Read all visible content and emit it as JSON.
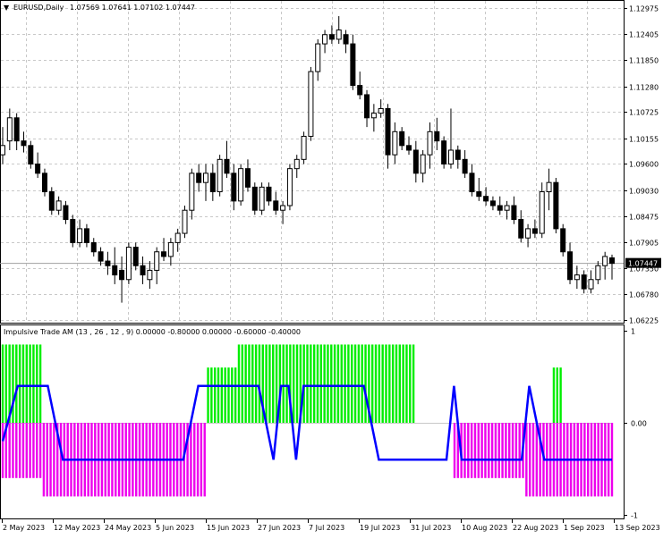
{
  "main_chart": {
    "title_prefix": "▼",
    "symbol_label": "EURUSD,Daily",
    "ohlc_text": "1.07569 1.07641 1.07102 1.07447",
    "current_price": "1.07447",
    "price_axis_ticks": [
      "1.12975",
      "1.12405",
      "1.11850",
      "1.11280",
      "1.10725",
      "1.10155",
      "1.09600",
      "1.09030",
      "1.08475",
      "1.07905",
      "1.07350",
      "1.06780",
      "1.06225"
    ],
    "colors": {
      "bull": "#ffffff",
      "bear": "#000000",
      "outline": "#000000",
      "grid": "#c0c0c0",
      "price_line": "#a0a0a0",
      "price_tag_bg": "#000000",
      "price_tag_text": "#ffffff"
    }
  },
  "indicator": {
    "title": "Impulsive Trade AM (13 , 26 , 12 , 9) 0.00000 -0.80000 0.00000 -0.60000 -0.40000",
    "axis_ticks": [
      "1",
      "0.00",
      "-1"
    ],
    "colors": {
      "up": "#00ee00",
      "down": "#ee00ee",
      "line": "#0000ff"
    }
  },
  "time_axis": [
    "2 May 2023",
    "12 May 2023",
    "24 May 2023",
    "5 Jun 2023",
    "15 Jun 2023",
    "27 Jun 2023",
    "7 Jul 2023",
    "19 Jul 2023",
    "31 Jul 2023",
    "10 Aug 2023",
    "22 Aug 2023",
    "1 Sep 2023",
    "13 Sep 2023"
  ],
  "chart_data": [
    {
      "type": "candlestick",
      "symbol": "EURUSD",
      "timeframe": "Daily",
      "ylim": [
        1.06225,
        1.12975
      ],
      "candles": [
        {
          "o": 1.098,
          "h": 1.104,
          "l": 1.096,
          "c": 1.1
        },
        {
          "o": 1.101,
          "h": 1.108,
          "l": 1.099,
          "c": 1.106
        },
        {
          "o": 1.106,
          "h": 1.107,
          "l": 1.099,
          "c": 1.101
        },
        {
          "o": 1.101,
          "h": 1.103,
          "l": 1.0985,
          "c": 1.1
        },
        {
          "o": 1.1,
          "h": 1.101,
          "l": 1.095,
          "c": 1.096
        },
        {
          "o": 1.096,
          "h": 1.0985,
          "l": 1.093,
          "c": 1.094
        },
        {
          "o": 1.094,
          "h": 1.095,
          "l": 1.089,
          "c": 1.09
        },
        {
          "o": 1.09,
          "h": 1.091,
          "l": 1.085,
          "c": 1.086
        },
        {
          "o": 1.086,
          "h": 1.089,
          "l": 1.085,
          "c": 1.088
        },
        {
          "o": 1.087,
          "h": 1.088,
          "l": 1.083,
          "c": 1.084
        },
        {
          "o": 1.084,
          "h": 1.085,
          "l": 1.078,
          "c": 1.079
        },
        {
          "o": 1.079,
          "h": 1.084,
          "l": 1.078,
          "c": 1.082
        },
        {
          "o": 1.082,
          "h": 1.083,
          "l": 1.078,
          "c": 1.079
        },
        {
          "o": 1.079,
          "h": 1.08,
          "l": 1.076,
          "c": 1.077
        },
        {
          "o": 1.077,
          "h": 1.078,
          "l": 1.074,
          "c": 1.075
        },
        {
          "o": 1.075,
          "h": 1.077,
          "l": 1.072,
          "c": 1.074
        },
        {
          "o": 1.074,
          "h": 1.078,
          "l": 1.07,
          "c": 1.072
        },
        {
          "o": 1.073,
          "h": 1.076,
          "l": 1.066,
          "c": 1.071
        },
        {
          "o": 1.071,
          "h": 1.079,
          "l": 1.07,
          "c": 1.078
        },
        {
          "o": 1.078,
          "h": 1.079,
          "l": 1.073,
          "c": 1.074
        },
        {
          "o": 1.074,
          "h": 1.076,
          "l": 1.07,
          "c": 1.072
        },
        {
          "o": 1.071,
          "h": 1.075,
          "l": 1.069,
          "c": 1.073
        },
        {
          "o": 1.073,
          "h": 1.078,
          "l": 1.07,
          "c": 1.077
        },
        {
          "o": 1.077,
          "h": 1.08,
          "l": 1.075,
          "c": 1.076
        },
        {
          "o": 1.076,
          "h": 1.08,
          "l": 1.074,
          "c": 1.079
        },
        {
          "o": 1.079,
          "h": 1.082,
          "l": 1.077,
          "c": 1.081
        },
        {
          "o": 1.081,
          "h": 1.087,
          "l": 1.08,
          "c": 1.086
        },
        {
          "o": 1.086,
          "h": 1.095,
          "l": 1.084,
          "c": 1.094
        },
        {
          "o": 1.094,
          "h": 1.096,
          "l": 1.09,
          "c": 1.092
        },
        {
          "o": 1.092,
          "h": 1.096,
          "l": 1.088,
          "c": 1.094
        },
        {
          "o": 1.094,
          "h": 1.096,
          "l": 1.088,
          "c": 1.09
        },
        {
          "o": 1.09,
          "h": 1.098,
          "l": 1.089,
          "c": 1.097
        },
        {
          "o": 1.097,
          "h": 1.101,
          "l": 1.093,
          "c": 1.094
        },
        {
          "o": 1.094,
          "h": 1.096,
          "l": 1.086,
          "c": 1.088
        },
        {
          "o": 1.088,
          "h": 1.096,
          "l": 1.087,
          "c": 1.095
        },
        {
          "o": 1.095,
          "h": 1.097,
          "l": 1.09,
          "c": 1.091
        },
        {
          "o": 1.091,
          "h": 1.092,
          "l": 1.085,
          "c": 1.086
        },
        {
          "o": 1.086,
          "h": 1.092,
          "l": 1.085,
          "c": 1.091
        },
        {
          "o": 1.091,
          "h": 1.092,
          "l": 1.087,
          "c": 1.088
        },
        {
          "o": 1.088,
          "h": 1.09,
          "l": 1.085,
          "c": 1.086
        },
        {
          "o": 1.086,
          "h": 1.088,
          "l": 1.083,
          "c": 1.087
        },
        {
          "o": 1.087,
          "h": 1.096,
          "l": 1.086,
          "c": 1.095
        },
        {
          "o": 1.095,
          "h": 1.098,
          "l": 1.093,
          "c": 1.097
        },
        {
          "o": 1.097,
          "h": 1.103,
          "l": 1.096,
          "c": 1.102
        },
        {
          "o": 1.102,
          "h": 1.117,
          "l": 1.101,
          "c": 1.116
        },
        {
          "o": 1.116,
          "h": 1.123,
          "l": 1.114,
          "c": 1.122
        },
        {
          "o": 1.122,
          "h": 1.125,
          "l": 1.12,
          "c": 1.124
        },
        {
          "o": 1.124,
          "h": 1.126,
          "l": 1.122,
          "c": 1.123
        },
        {
          "o": 1.123,
          "h": 1.128,
          "l": 1.122,
          "c": 1.125
        },
        {
          "o": 1.124,
          "h": 1.125,
          "l": 1.12,
          "c": 1.122
        },
        {
          "o": 1.122,
          "h": 1.124,
          "l": 1.112,
          "c": 1.113
        },
        {
          "o": 1.113,
          "h": 1.116,
          "l": 1.11,
          "c": 1.111
        },
        {
          "o": 1.111,
          "h": 1.112,
          "l": 1.104,
          "c": 1.106
        },
        {
          "o": 1.106,
          "h": 1.109,
          "l": 1.103,
          "c": 1.107
        },
        {
          "o": 1.107,
          "h": 1.11,
          "l": 1.106,
          "c": 1.108
        },
        {
          "o": 1.108,
          "h": 1.109,
          "l": 1.095,
          "c": 1.098
        },
        {
          "o": 1.098,
          "h": 1.105,
          "l": 1.096,
          "c": 1.103
        },
        {
          "o": 1.103,
          "h": 1.104,
          "l": 1.099,
          "c": 1.1
        },
        {
          "o": 1.1,
          "h": 1.102,
          "l": 1.098,
          "c": 1.099
        },
        {
          "o": 1.099,
          "h": 1.101,
          "l": 1.092,
          "c": 1.094
        },
        {
          "o": 1.094,
          "h": 1.099,
          "l": 1.092,
          "c": 1.098
        },
        {
          "o": 1.098,
          "h": 1.105,
          "l": 1.095,
          "c": 1.103
        },
        {
          "o": 1.103,
          "h": 1.106,
          "l": 1.099,
          "c": 1.101
        },
        {
          "o": 1.101,
          "h": 1.102,
          "l": 1.095,
          "c": 1.096
        },
        {
          "o": 1.096,
          "h": 1.108,
          "l": 1.095,
          "c": 1.099
        },
        {
          "o": 1.099,
          "h": 1.1,
          "l": 1.095,
          "c": 1.097
        },
        {
          "o": 1.097,
          "h": 1.099,
          "l": 1.093,
          "c": 1.094
        },
        {
          "o": 1.094,
          "h": 1.096,
          "l": 1.089,
          "c": 1.09
        },
        {
          "o": 1.09,
          "h": 1.093,
          "l": 1.088,
          "c": 1.089
        },
        {
          "o": 1.089,
          "h": 1.091,
          "l": 1.087,
          "c": 1.088
        },
        {
          "o": 1.088,
          "h": 1.089,
          "l": 1.086,
          "c": 1.087
        },
        {
          "o": 1.087,
          "h": 1.089,
          "l": 1.085,
          "c": 1.086
        },
        {
          "o": 1.086,
          "h": 1.088,
          "l": 1.084,
          "c": 1.087
        },
        {
          "o": 1.087,
          "h": 1.089,
          "l": 1.083,
          "c": 1.084
        },
        {
          "o": 1.084,
          "h": 1.086,
          "l": 1.079,
          "c": 1.08
        },
        {
          "o": 1.08,
          "h": 1.083,
          "l": 1.078,
          "c": 1.082
        },
        {
          "o": 1.082,
          "h": 1.084,
          "l": 1.08,
          "c": 1.081
        },
        {
          "o": 1.081,
          "h": 1.092,
          "l": 1.08,
          "c": 1.09
        },
        {
          "o": 1.09,
          "h": 1.095,
          "l": 1.086,
          "c": 1.092
        },
        {
          "o": 1.092,
          "h": 1.093,
          "l": 1.081,
          "c": 1.082
        },
        {
          "o": 1.082,
          "h": 1.083,
          "l": 1.076,
          "c": 1.077
        },
        {
          "o": 1.077,
          "h": 1.079,
          "l": 1.07,
          "c": 1.071
        },
        {
          "o": 1.071,
          "h": 1.074,
          "l": 1.069,
          "c": 1.072
        },
        {
          "o": 1.072,
          "h": 1.073,
          "l": 1.068,
          "c": 1.069
        },
        {
          "o": 1.069,
          "h": 1.073,
          "l": 1.068,
          "c": 1.071
        },
        {
          "o": 1.071,
          "h": 1.075,
          "l": 1.07,
          "c": 1.074
        },
        {
          "o": 1.074,
          "h": 1.077,
          "l": 1.071,
          "c": 1.076
        },
        {
          "o": 1.0757,
          "h": 1.0764,
          "l": 1.071,
          "c": 1.0745
        }
      ]
    },
    {
      "type": "histogram",
      "name": "Impulsive Trade AM (13 , 26 , 12 , 9)",
      "ylim": [
        -1,
        1
      ],
      "series": [
        {
          "name": "up",
          "color": "#00ee00",
          "values": [
            0.85,
            0.85,
            0.85,
            0.85,
            0.85,
            0.85,
            0.85,
            0.85,
            0.85,
            0.85,
            0.85,
            0.85,
            0,
            0,
            0,
            0,
            0,
            0,
            0,
            0,
            0,
            0,
            0,
            0,
            0,
            0,
            0,
            0,
            0,
            0,
            0,
            0,
            0,
            0,
            0,
            0,
            0,
            0,
            0,
            0,
            0,
            0,
            0,
            0,
            0,
            0,
            0,
            0,
            0,
            0,
            0,
            0,
            0,
            0,
            0,
            0,
            0,
            0,
            0,
            0,
            0.6,
            0.6,
            0.6,
            0.6,
            0.6,
            0.6,
            0.6,
            0.6,
            0.6,
            0.85,
            0.85,
            0.85,
            0.85,
            0.85,
            0.85,
            0.85,
            0.85,
            0.85,
            0.85,
            0.85,
            0.85,
            0.85,
            0.85,
            0.85,
            0.85,
            0.85,
            0.85,
            0.85,
            0.85,
            0.85,
            0.85,
            0.85,
            0.85,
            0.85,
            0.85,
            0.85,
            0.85,
            0.85,
            0.85,
            0.85,
            0.85,
            0.85,
            0.85,
            0.85,
            0.85,
            0.85,
            0.85,
            0.85,
            0.85,
            0.85,
            0.85,
            0.85,
            0.85,
            0.85,
            0.85,
            0.85,
            0.85,
            0.85,
            0.85,
            0.85,
            0.85,
            0,
            0,
            0,
            0,
            0,
            0,
            0,
            0,
            0,
            0,
            0,
            0,
            0,
            0,
            0,
            0,
            0,
            0,
            0,
            0,
            0,
            0,
            0,
            0,
            0,
            0,
            0,
            0,
            0,
            0,
            0,
            0,
            0,
            0,
            0,
            0,
            0,
            0,
            0,
            0,
            0.6,
            0.6,
            0.6,
            0,
            0,
            0,
            0,
            0,
            0,
            0,
            0,
            0,
            0,
            0,
            0,
            0,
            0,
            0
          ]
        },
        {
          "name": "down",
          "color": "#ee00ee",
          "values": [
            -0.6,
            -0.6,
            -0.6,
            -0.6,
            -0.6,
            -0.6,
            -0.6,
            -0.6,
            -0.6,
            -0.6,
            -0.6,
            -0.6,
            -0.8,
            -0.8,
            -0.8,
            -0.8,
            -0.8,
            -0.8,
            -0.8,
            -0.8,
            -0.8,
            -0.8,
            -0.8,
            -0.8,
            -0.8,
            -0.8,
            -0.8,
            -0.8,
            -0.8,
            -0.8,
            -0.8,
            -0.8,
            -0.8,
            -0.8,
            -0.8,
            -0.8,
            -0.8,
            -0.8,
            -0.8,
            -0.8,
            -0.8,
            -0.8,
            -0.8,
            -0.8,
            -0.8,
            -0.8,
            -0.8,
            -0.8,
            -0.8,
            -0.8,
            -0.8,
            -0.8,
            -0.8,
            -0.8,
            -0.8,
            -0.8,
            -0.8,
            -0.8,
            -0.8,
            -0.8,
            0,
            0,
            0,
            0,
            0,
            0,
            0,
            0,
            0,
            0,
            0,
            0,
            0,
            0,
            0,
            0,
            0,
            0,
            0,
            0,
            0,
            0,
            0,
            0,
            0,
            0,
            0,
            0,
            0,
            0,
            0,
            0,
            0,
            0,
            0,
            0,
            0,
            0,
            0,
            0,
            0,
            0,
            0,
            0,
            0,
            0,
            0,
            0,
            0,
            0,
            0,
            0,
            0,
            0,
            0,
            0,
            0,
            0,
            0,
            0,
            0,
            0,
            0,
            0,
            0,
            0,
            0,
            0,
            0,
            0,
            0,
            0,
            -0.6,
            -0.6,
            -0.6,
            -0.6,
            -0.6,
            -0.6,
            -0.6,
            -0.6,
            -0.6,
            -0.6,
            -0.6,
            -0.6,
            -0.6,
            -0.6,
            -0.6,
            -0.6,
            -0.6,
            -0.6,
            -0.6,
            -0.6,
            -0.6,
            -0.8,
            -0.8,
            -0.8,
            -0.8,
            -0.8,
            -0.8,
            -0.8,
            -0.8,
            -0.8,
            -0.8,
            -0.8,
            -0.8,
            -0.8,
            -0.8,
            -0.8,
            -0.8,
            -0.8,
            -0.8,
            -0.8,
            -0.8,
            -0.8,
            -0.8,
            -0.8,
            -0.8,
            -0.8,
            -0.8,
            -0.8,
            -0.8,
            -0.8,
            -0.8,
            -0.8,
            -0.8,
            -0.8
          ]
        },
        {
          "name": "line",
          "color": "#0000ff",
          "points": [
            [
              0,
              -0.2
            ],
            [
              2,
              0.4
            ],
            [
              6,
              0.4
            ],
            [
              8,
              -0.4
            ],
            [
              24,
              -0.4
            ],
            [
              26,
              0.4
            ],
            [
              34,
              0.4
            ],
            [
              36,
              -0.4
            ],
            [
              37,
              0.4
            ],
            [
              38,
              0.4
            ],
            [
              39,
              -0.4
            ],
            [
              40,
              0.4
            ],
            [
              48,
              0.4
            ],
            [
              50,
              -0.4
            ],
            [
              59,
              -0.4
            ],
            [
              60,
              0.4
            ],
            [
              61,
              -0.4
            ],
            [
              69,
              -0.4
            ],
            [
              70,
              0.4
            ],
            [
              72,
              -0.4
            ],
            [
              81,
              -0.4
            ]
          ]
        }
      ]
    }
  ]
}
